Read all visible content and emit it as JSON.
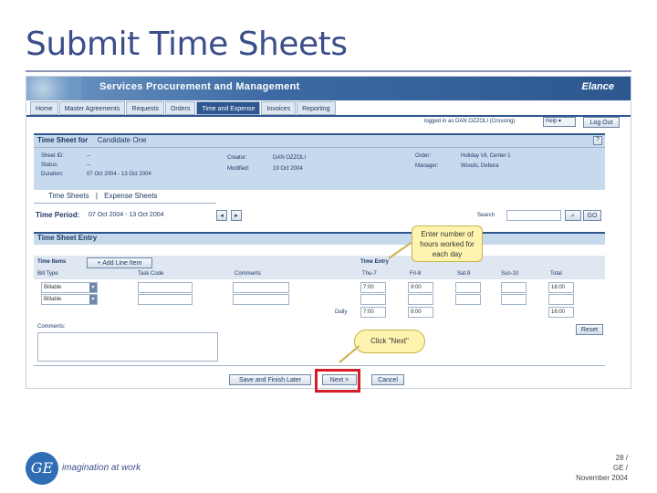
{
  "slide": {
    "title": "Submit Time Sheets",
    "page": "28 /",
    "company": "GE /",
    "date": "November 2004",
    "footer_logo": "GE",
    "footer_tagline": "imagination at work"
  },
  "app": {
    "title": "Services Procurement and Management",
    "logo": "Elance",
    "tabs": [
      "Home",
      "Master Agreements",
      "Requests",
      "Orders",
      "Time and Expense",
      "Invoices",
      "Reporting"
    ],
    "active_tab": "Time and Expense",
    "logged_in": "logged in as DAN OZZOLI (Crossing)",
    "help_label": "Help",
    "logout_label": "Log Out"
  },
  "sheet": {
    "heading": "Time Sheet for",
    "candidate": "Candidate One",
    "help_icon": "?",
    "fields": [
      {
        "label": "Sheet ID:",
        "value": "--"
      },
      {
        "label": "Status:",
        "value": "--"
      },
      {
        "label": "Duration:",
        "value": "07 Oct 2004 - 13 Oct 2004"
      }
    ],
    "meta": [
      {
        "label": "Creator:",
        "value": "DAN OZZOLI"
      },
      {
        "label": "Modified:",
        "value": "19 Oct 2004"
      }
    ],
    "order": [
      {
        "label": "Order:",
        "value": "Holiday Vil, Center 1"
      },
      {
        "label": "Manager:",
        "value": "Woods, Debora"
      }
    ]
  },
  "subtabs": {
    "time_sheets": "Time Sheets",
    "separator": "|",
    "expense_sheets": "Expense Sheets"
  },
  "period": {
    "label": "Time Period:",
    "value": "07 Oct 2004 - 13 Oct 2004",
    "prev_icon": "◂",
    "next_icon": "▸",
    "search_label": "Search",
    "go_label": "GO"
  },
  "entry": {
    "heading": "Time Sheet Entry",
    "time_items_label": "Time Items",
    "add_line_label": "+ Add Line Item",
    "time_entry_label": "Time Entry",
    "columns": [
      "Bill Type",
      "Task Code",
      "Comments",
      "Thu-7",
      "Fri-8",
      "Sat-9",
      "Sun-10",
      "Total"
    ],
    "rows": [
      {
        "bill_type": "Billable",
        "thu": "7:00",
        "fri": "9:00",
        "sat": "",
        "sun": "",
        "total": "16:00"
      },
      {
        "bill_type": "Billable",
        "thu": "",
        "fri": "",
        "sat": "",
        "sun": "",
        "total": ""
      }
    ],
    "daily_label": "Daily",
    "daily": {
      "thu": "7:00",
      "fri": "9:00",
      "total": "16:00"
    },
    "comments_label": "Comments:",
    "reset_label": "Reset"
  },
  "buttons": {
    "save_label": "Save and Finish Later",
    "next_label": "Next >",
    "cancel_label": "Cancel"
  },
  "callouts": {
    "hours": "Enter number of hours worked for each day",
    "next": "Click \"Next\""
  },
  "colors": {
    "title": "#3c4f8a",
    "banner": "#2d578e",
    "highlight": "#d21f2a",
    "callout": "#fff3b0"
  }
}
